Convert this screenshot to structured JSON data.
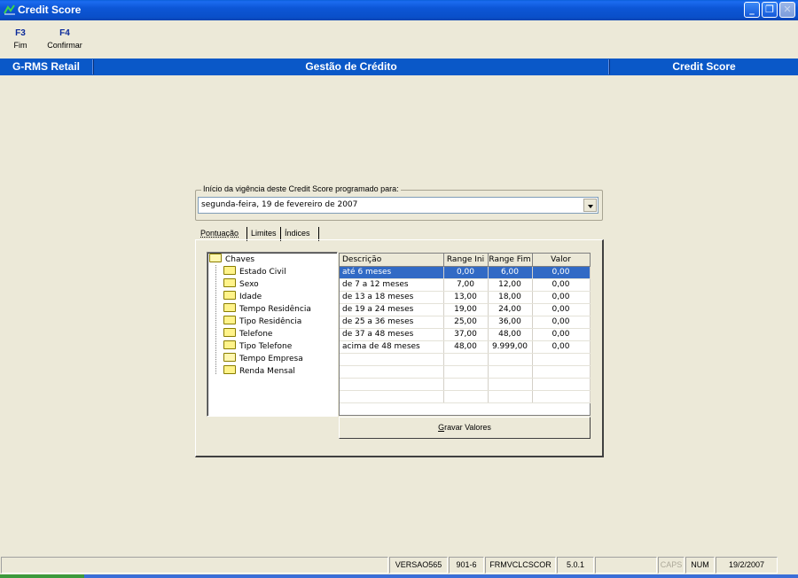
{
  "window": {
    "title": "Credit Score",
    "minimize": "_",
    "restore": "❐",
    "close": "✕"
  },
  "toolbar": {
    "keys": [
      {
        "key": "F3",
        "label": "Fim"
      },
      {
        "key": "F4",
        "label": "Confirmar"
      }
    ]
  },
  "header": {
    "left": "G-RMS Retail",
    "center": "Gestão de Crédito",
    "right": "Credit Score"
  },
  "vigencia": {
    "legend": "Início da vigência deste Credit Score programado para:",
    "value": "segunda-feira, 19 de  fevereiro  de 2007"
  },
  "tabs": [
    "Pontuação",
    "Limites",
    "Índices"
  ],
  "tree": {
    "root": "Chaves",
    "children": [
      "Estado Civil",
      "Sexo",
      "Idade",
      "Tempo Residência",
      "Tipo Residência",
      "Telefone",
      "Tipo Telefone",
      "Tempo Empresa",
      "Renda Mensal"
    ]
  },
  "grid": {
    "columns": [
      "Descrição",
      "Range Ini",
      "Range Fim",
      "Valor"
    ],
    "rows": [
      [
        "até 6 meses",
        "0,00",
        "6,00",
        "0,00"
      ],
      [
        "de 7 a 12 meses",
        "7,00",
        "12,00",
        "0,00"
      ],
      [
        "de 13 a 18 meses",
        "13,00",
        "18,00",
        "0,00"
      ],
      [
        "de 19 a 24 meses",
        "19,00",
        "24,00",
        "0,00"
      ],
      [
        "de 25 a 36 meses",
        "25,00",
        "36,00",
        "0,00"
      ],
      [
        "de 37 a 48 meses",
        "37,00",
        "48,00",
        "0,00"
      ],
      [
        "acima de 48 meses",
        "48,00",
        "9.999,00",
        "0,00"
      ]
    ],
    "selected_row": 0
  },
  "gravar": {
    "access_key": "G",
    "rest": "ravar Valores"
  },
  "status": {
    "version": "VERSAO565",
    "code": "901-6",
    "form": "FRMVCLCSCOR",
    "release": "5.0.1",
    "caps": "CAPS",
    "num": "NUM",
    "date": "19/2/2007"
  },
  "colors": {
    "accent": "#0a58c8",
    "selection": "#316ac5",
    "window_bg": "#ece9d8"
  }
}
